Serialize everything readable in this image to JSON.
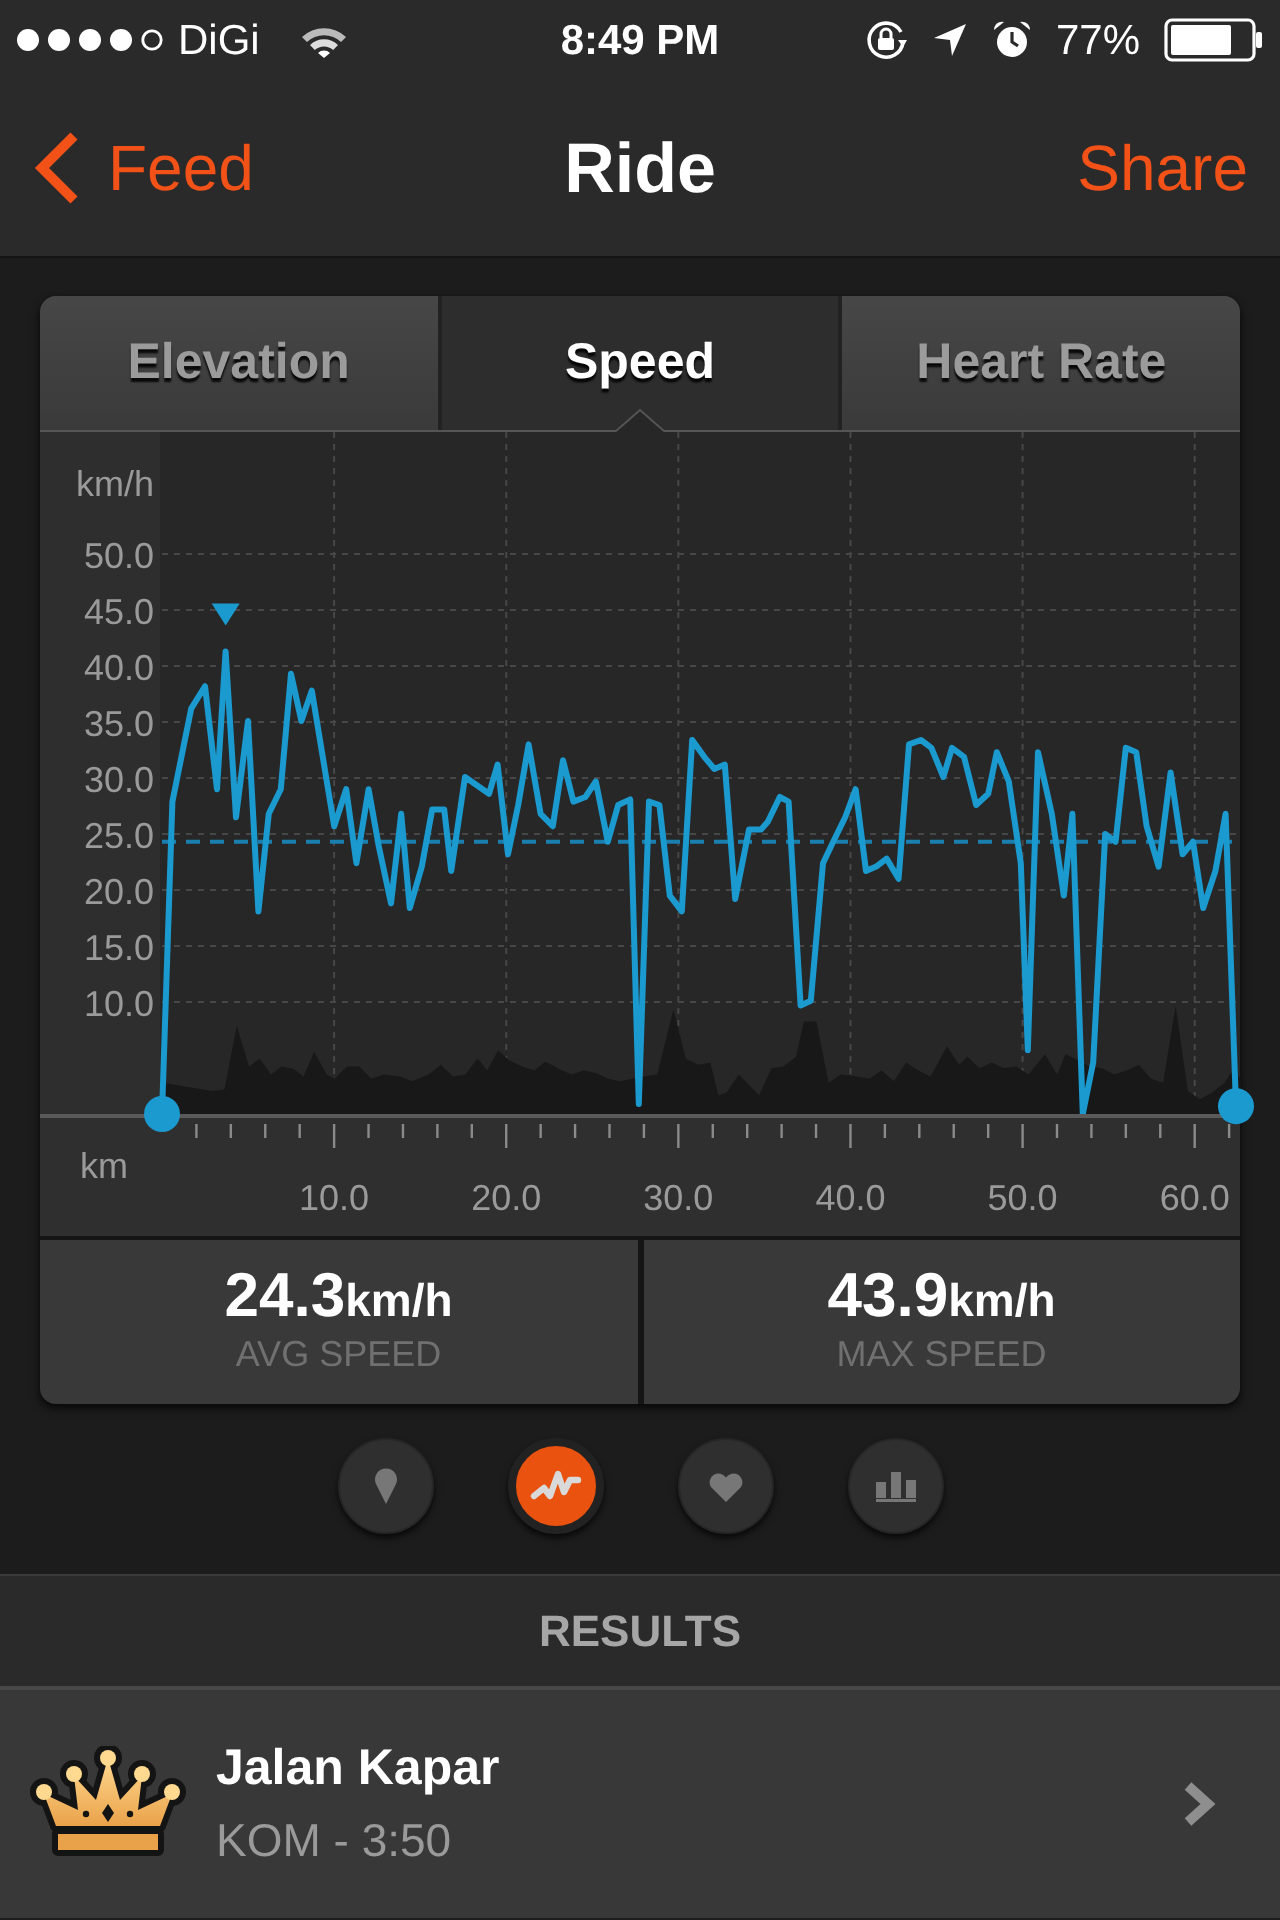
{
  "status_bar": {
    "carrier": "DiGi",
    "time": "8:49 PM",
    "battery": "77%"
  },
  "navigation": {
    "back": "Feed",
    "title": "Ride",
    "action": "Share"
  },
  "tabs": [
    {
      "label": "Elevation",
      "selected": false
    },
    {
      "label": "Speed",
      "selected": true
    },
    {
      "label": "Heart Rate",
      "selected": false
    }
  ],
  "speed_chart": {
    "chart_data": {
      "type": "line",
      "xlabel": "km",
      "ylabel": "km/h",
      "x": [
        0,
        0.6,
        1.7,
        2.5,
        3.2,
        3.7,
        4.3,
        5.0,
        5.6,
        6.2,
        6.9,
        7.5,
        8.1,
        8.7,
        10.0,
        10.7,
        11.3,
        12.0,
        12.6,
        13.3,
        13.9,
        14.4,
        15.1,
        15.7,
        16.4,
        16.8,
        17.6,
        19.0,
        19.5,
        20.1,
        20.7,
        21.3,
        22.0,
        22.7,
        23.3,
        23.9,
        24.6,
        25.2,
        25.9,
        26.5,
        27.2,
        27.7,
        28.3,
        28.9,
        29.5,
        30.2,
        30.8,
        31.5,
        32.1,
        32.7,
        33.3,
        34.1,
        34.8,
        35.2,
        35.9,
        36.4,
        37.1,
        37.7,
        38.4,
        39.0,
        39.7,
        40.3,
        40.9,
        41.5,
        42.1,
        42.8,
        43.4,
        44.1,
        44.7,
        45.4,
        45.9,
        46.6,
        47.3,
        48.0,
        48.5,
        49.2,
        49.9,
        50.3,
        50.9,
        51.7,
        52.4,
        52.9,
        53.5,
        54.1,
        54.8,
        55.4,
        56.0,
        56.6,
        57.2,
        57.9,
        58.6,
        59.3,
        59.9,
        60.5,
        61.2,
        61.8,
        62.4
      ],
      "values": [
        0,
        27.9,
        36.2,
        38.2,
        29.0,
        41.3,
        26.5,
        35.1,
        18.1,
        26.8,
        29.0,
        39.3,
        35.1,
        37.8,
        25.7,
        29.0,
        22.4,
        29.0,
        23.9,
        18.8,
        26.8,
        18.4,
        22.1,
        27.2,
        27.2,
        21.7,
        30.1,
        28.6,
        31.2,
        23.2,
        27.6,
        33.0,
        26.8,
        25.7,
        31.6,
        27.9,
        28.3,
        29.7,
        24.3,
        27.6,
        28.1,
        0.9,
        27.9,
        27.6,
        19.5,
        18.1,
        33.4,
        31.9,
        30.8,
        31.2,
        19.2,
        25.4,
        25.4,
        26.1,
        28.3,
        27.9,
        9.7,
        10.1,
        22.4,
        24.3,
        26.5,
        29.0,
        21.7,
        22.1,
        22.8,
        21.0,
        33.0,
        33.4,
        32.7,
        30.1,
        32.7,
        31.9,
        27.6,
        28.6,
        32.3,
        29.7,
        22.4,
        5.7,
        32.3,
        26.8,
        19.5,
        26.8,
        0.0,
        4.6,
        25.0,
        24.3,
        32.7,
        32.3,
        25.7,
        22.1,
        30.5,
        23.2,
        24.3,
        18.4,
        21.7,
        26.8,
        0.7
      ],
      "xlim": [
        0,
        62.4
      ],
      "ylim": [
        0,
        60.9
      ],
      "xticks": [
        {
          "value": 10,
          "label": "10.0"
        },
        {
          "value": 20,
          "label": "20.0"
        },
        {
          "value": 30,
          "label": "30.0"
        },
        {
          "value": 40,
          "label": "40.0"
        },
        {
          "value": 50,
          "label": "50.0"
        },
        {
          "value": 60,
          "label": "60.0"
        }
      ],
      "yticks": [
        {
          "value": 10,
          "label": "10.0"
        },
        {
          "value": 15,
          "label": "15.0"
        },
        {
          "value": 20,
          "label": "20.0"
        },
        {
          "value": 25,
          "label": "25.0"
        },
        {
          "value": 30,
          "label": "30.0"
        },
        {
          "value": 35,
          "label": "35.0"
        },
        {
          "value": 40,
          "label": "40.0"
        },
        {
          "value": 45,
          "label": "45.0"
        },
        {
          "value": 50,
          "label": "50.0"
        }
      ],
      "grid": true,
      "ref_lines": [
        {
          "axis": "y",
          "value": 24.3
        }
      ]
    }
  },
  "stats": [
    {
      "value": "24.3",
      "unit": "km/h",
      "label": "AVG SPEED"
    },
    {
      "value": "43.9",
      "unit": "km/h",
      "label": "MAX SPEED"
    }
  ],
  "view_buttons": [
    {
      "selected": false
    },
    {
      "selected": true
    },
    {
      "selected": false
    },
    {
      "selected": false
    }
  ],
  "results": {
    "title": "RESULTS",
    "items": [
      {
        "name": "Jalan Kapar",
        "detail": "KOM - 3:50"
      }
    ]
  }
}
